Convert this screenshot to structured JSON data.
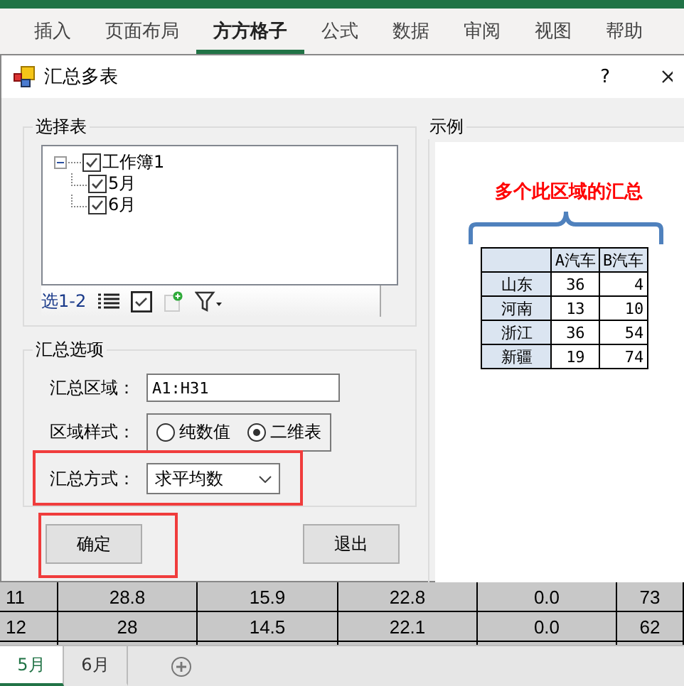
{
  "ribbon_tabs": [
    {
      "label": "插入",
      "selected": false
    },
    {
      "label": "页面布局",
      "selected": false
    },
    {
      "label": "方方格子",
      "selected": true
    },
    {
      "label": "公式",
      "selected": false
    },
    {
      "label": "数据",
      "selected": false
    },
    {
      "label": "审阅",
      "selected": false
    },
    {
      "label": "视图",
      "selected": false
    },
    {
      "label": "帮助",
      "selected": false
    }
  ],
  "dialog": {
    "title": "汇总多表",
    "help": "?",
    "select_group": {
      "title": "选择表",
      "tree": [
        {
          "label": "工作簿1",
          "checked": true,
          "expanded": true,
          "children": [
            {
              "label": "5月",
              "checked": true
            },
            {
              "label": "6月",
              "checked": true
            }
          ]
        }
      ],
      "count": "选1-2"
    },
    "options_group": {
      "title": "汇总选项",
      "area": {
        "label": "汇总区域：",
        "value": "A1:H31"
      },
      "style": {
        "label": "区域样式：",
        "options": [
          {
            "label": "纯数值",
            "selected": false
          },
          {
            "label": "二维表",
            "selected": true
          }
        ]
      },
      "method": {
        "label": "汇总方式：",
        "value": "求平均数",
        "highlighted": true
      }
    },
    "buttons": [
      {
        "label": "确定",
        "highlighted": true
      },
      {
        "label": "退出"
      }
    ],
    "example": {
      "title": "示例",
      "caption": "多个此区域的汇总",
      "columns": [
        "A汽车",
        "B汽车"
      ],
      "rows": [
        {
          "label": "山东",
          "values": [
            "36",
            "4"
          ]
        },
        {
          "label": "河南",
          "values": [
            "13",
            "10"
          ]
        },
        {
          "label": "浙江",
          "values": [
            "36",
            "54"
          ]
        },
        {
          "label": "新疆",
          "values": [
            "19",
            "74"
          ]
        }
      ]
    }
  },
  "sheet": {
    "rows": [
      {
        "header": "11",
        "cells": [
          "28.8",
          "15.9",
          "22.8",
          "0.0",
          "73"
        ]
      },
      {
        "header": "12",
        "cells": [
          "28",
          "14.5",
          "22.1",
          "0.0",
          "62"
        ]
      }
    ]
  },
  "sheet_tabs": [
    {
      "label": "5月",
      "selected": true
    },
    {
      "label": "6月",
      "selected": false
    }
  ]
}
